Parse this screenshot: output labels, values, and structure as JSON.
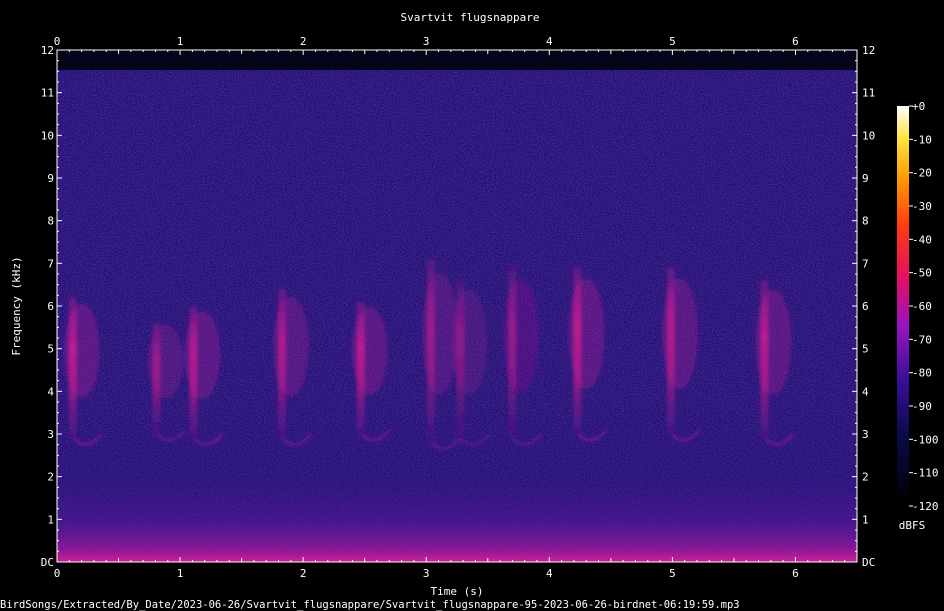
{
  "chart_data": {
    "type": "heatmap",
    "title": "Svartvit flugsnappare",
    "xlabel": "Time (s)",
    "ylabel": "Frequency (kHz)",
    "xlim": [
      0,
      6.5
    ],
    "ylim": [
      0,
      12
    ],
    "x_ticks": [
      "0",
      "1",
      "2",
      "3",
      "4",
      "5",
      "6"
    ],
    "y_ticks": [
      "DC",
      "1",
      "2",
      "3",
      "4",
      "5",
      "6",
      "7",
      "8",
      "9",
      "10",
      "11",
      "12"
    ],
    "colorbar": {
      "label": "dBFS",
      "range": [
        -120,
        0
      ],
      "ticks": [
        "+0",
        "-10",
        "-20",
        "-30",
        "-40",
        "-50",
        "-60",
        "-70",
        "-80",
        "-90",
        "-100",
        "-110",
        "-120"
      ]
    },
    "footer": "BirdSongs/Extracted/By_Date/2023-06-26/Svartvit_flugsnappare/Svartvit_flugsnappare-95-2023-06-26-birdnet-06:19:59.mp3",
    "calls": [
      {
        "t": 0.12,
        "f_low": 2.9,
        "f_high": 6.2,
        "level": -62
      },
      {
        "t": 0.8,
        "f_low": 3.0,
        "f_high": 5.6,
        "level": -70
      },
      {
        "t": 1.1,
        "f_low": 2.9,
        "f_high": 6.0,
        "level": -64
      },
      {
        "t": 1.82,
        "f_low": 2.9,
        "f_high": 6.4,
        "level": -66
      },
      {
        "t": 2.46,
        "f_low": 3.0,
        "f_high": 6.1,
        "level": -63
      },
      {
        "t": 3.03,
        "f_low": 2.8,
        "f_high": 7.1,
        "level": -70
      },
      {
        "t": 3.27,
        "f_low": 2.9,
        "f_high": 6.6,
        "level": -74
      },
      {
        "t": 3.69,
        "f_low": 2.9,
        "f_high": 6.9,
        "level": -72
      },
      {
        "t": 4.22,
        "f_low": 3.0,
        "f_high": 6.9,
        "level": -62
      },
      {
        "t": 4.98,
        "f_low": 3.0,
        "f_high": 6.9,
        "level": -64
      },
      {
        "t": 5.74,
        "f_low": 2.9,
        "f_high": 6.6,
        "level": -63
      }
    ]
  }
}
